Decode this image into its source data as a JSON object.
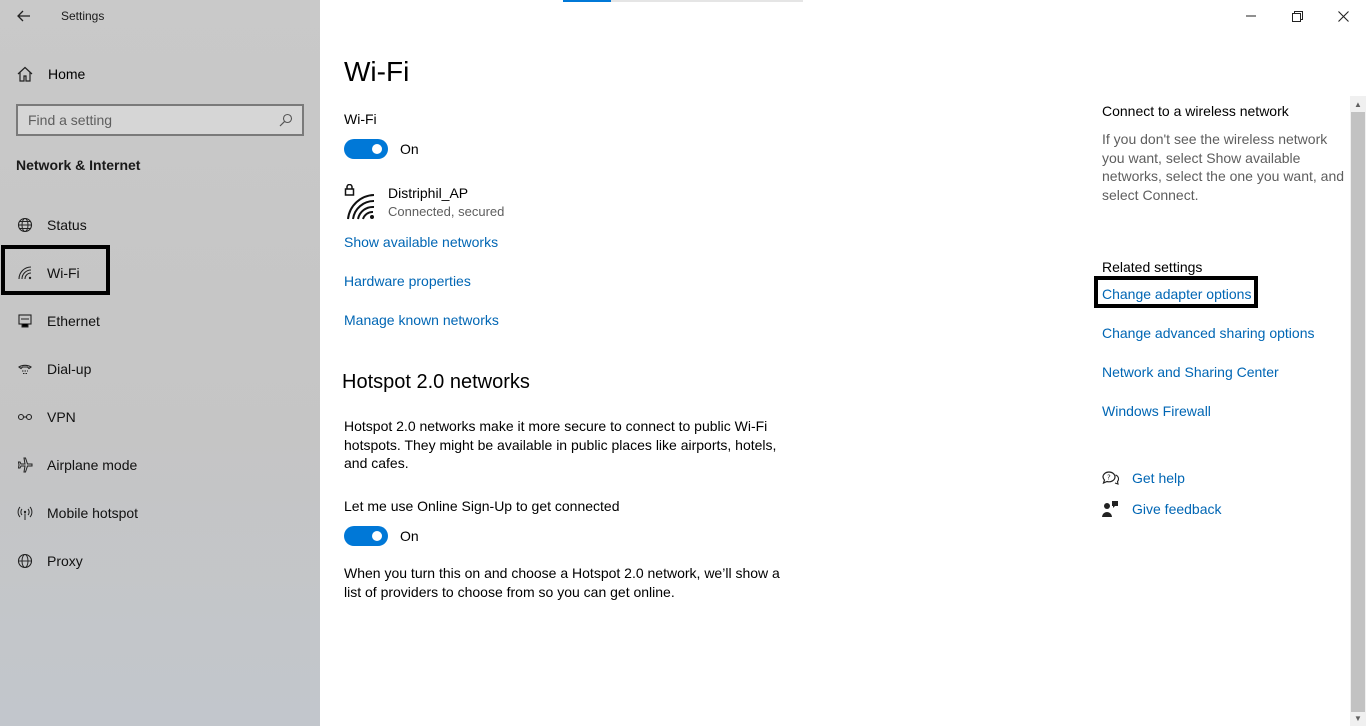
{
  "window": {
    "title": "Settings",
    "controls": {
      "minimize": "—",
      "maximize": "❐",
      "close": "✕"
    }
  },
  "sidebar": {
    "home_label": "Home",
    "search_placeholder": "Find a setting",
    "section_title": "Network & Internet",
    "items": [
      {
        "label": "Status",
        "icon": "status-globe-icon"
      },
      {
        "label": "Wi-Fi",
        "icon": "wifi-icon",
        "selected": true
      },
      {
        "label": "Ethernet",
        "icon": "ethernet-icon"
      },
      {
        "label": "Dial-up",
        "icon": "dialup-icon"
      },
      {
        "label": "VPN",
        "icon": "vpn-icon"
      },
      {
        "label": "Airplane mode",
        "icon": "airplane-icon"
      },
      {
        "label": "Mobile hotspot",
        "icon": "hotspot-icon"
      },
      {
        "label": "Proxy",
        "icon": "proxy-globe-icon"
      }
    ]
  },
  "main": {
    "title": "Wi-Fi",
    "wifi_label": "Wi-Fi",
    "wifi_toggle": {
      "state": "On"
    },
    "network": {
      "name": "Distriphil_AP",
      "status": "Connected, secured"
    },
    "links": {
      "show_available": "Show available networks",
      "hardware": "Hardware properties",
      "manage_known": "Manage known networks"
    },
    "hotspot": {
      "title": "Hotspot 2.0 networks",
      "description": "Hotspot 2.0 networks make it more secure to connect to public Wi-Fi hotspots. They might be available in public places like airports, hotels, and cafes.",
      "signup_label": "Let me use Online Sign-Up to get connected",
      "signup_toggle": {
        "state": "On"
      },
      "footer": "When you turn this on and choose a Hotspot 2.0 network, we’ll show a list of providers to choose from so you can get online."
    }
  },
  "right_panel": {
    "connect_title": "Connect to a wireless network",
    "connect_desc": "If you don't see the wireless network you want, select Show available networks, select the one you want, and select Connect.",
    "related_title": "Related settings",
    "related_links": [
      "Change adapter options",
      "Change advanced sharing options",
      "Network and Sharing Center",
      "Windows Firewall"
    ],
    "help": {
      "get_help": "Get help",
      "give_feedback": "Give feedback"
    }
  },
  "colors": {
    "accent": "#0078d7",
    "link": "#0066b4",
    "sidebar_bg": "#c9c9c9"
  }
}
